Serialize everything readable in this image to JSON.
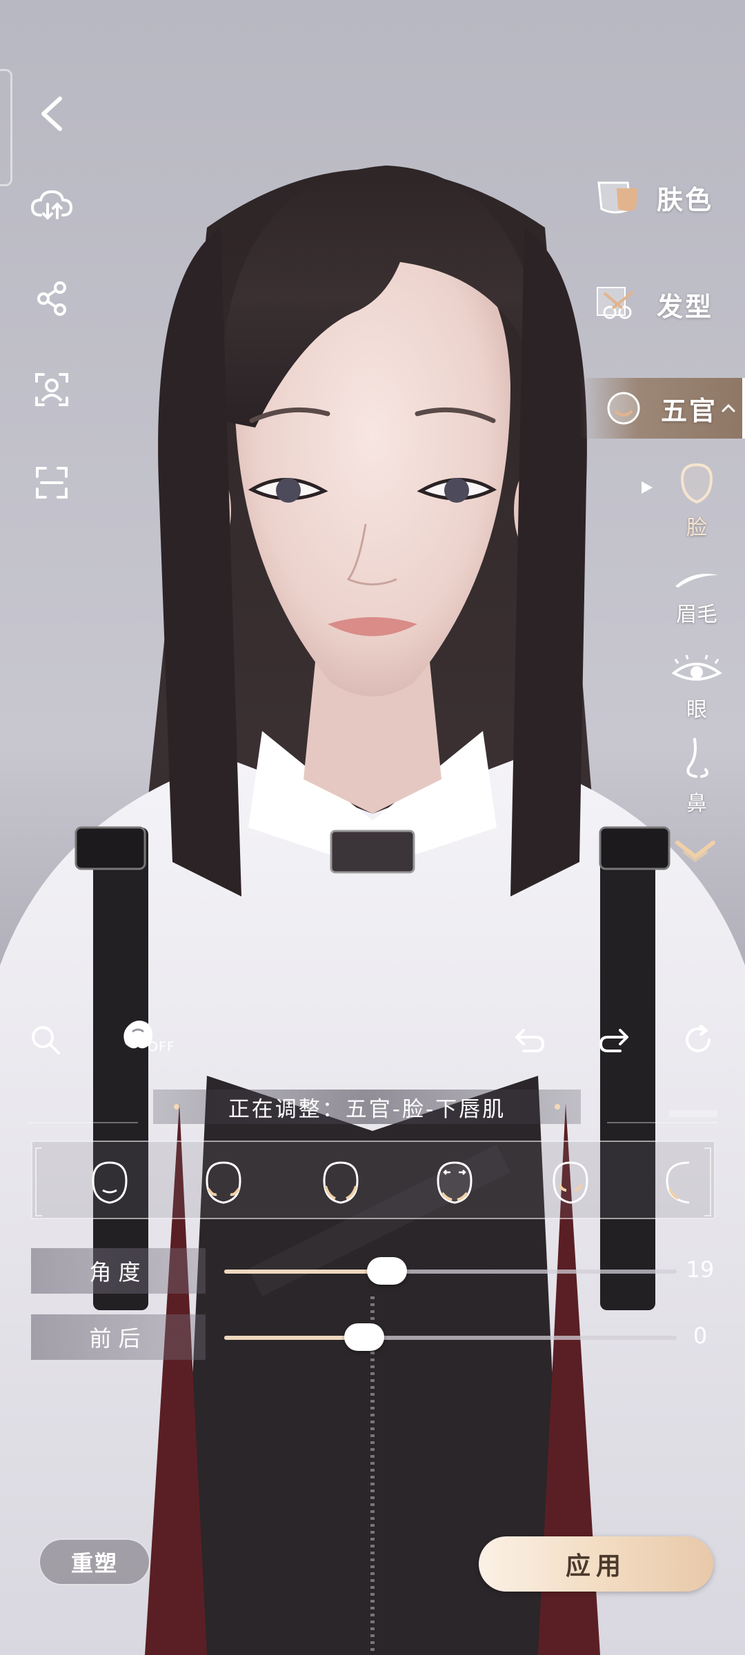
{
  "left_toolbar": {
    "items": [
      {
        "name": "back",
        "icon": "chevron-left-icon"
      },
      {
        "name": "cloud",
        "icon": "cloud-sync-icon"
      },
      {
        "name": "share",
        "icon": "share-icon"
      },
      {
        "name": "face-scan",
        "icon": "person-frame-icon"
      },
      {
        "name": "screenshot",
        "icon": "scan-frame-icon"
      }
    ]
  },
  "categories": [
    {
      "label": "肤色",
      "icon": "skin-swatch-icon"
    },
    {
      "label": "发型",
      "icon": "scissors-icon"
    },
    {
      "label": "五官",
      "icon": "face-icon",
      "expanded": true
    }
  ],
  "subcategories": [
    {
      "label": "脸",
      "icon": "face-outline-icon",
      "active": true
    },
    {
      "label": "眉毛",
      "icon": "eyebrow-icon"
    },
    {
      "label": "眼",
      "icon": "eye-icon"
    },
    {
      "label": "鼻",
      "icon": "nose-icon"
    }
  ],
  "toolbar": {
    "search_icon": "search-icon",
    "effect_toggle_label": "OFF",
    "undo_icon": "undo-icon",
    "redo_icon": "redo-icon",
    "reset_icon": "refresh-icon"
  },
  "status": {
    "text": "正在调整：五官-脸-下唇肌"
  },
  "face_shapes": {
    "count": 6,
    "selected_index": 3
  },
  "sliders": [
    {
      "label": "角度",
      "value": 19,
      "fraction": 0.36
    },
    {
      "label": "前后",
      "value": 0,
      "fraction": 0.31
    }
  ],
  "buttons": {
    "reset_label": "重塑",
    "apply_label": "应用"
  },
  "colors": {
    "accent": "#efd8bf",
    "apply_button": "#f3ddc4",
    "apply_text": "#4b3a2d"
  }
}
